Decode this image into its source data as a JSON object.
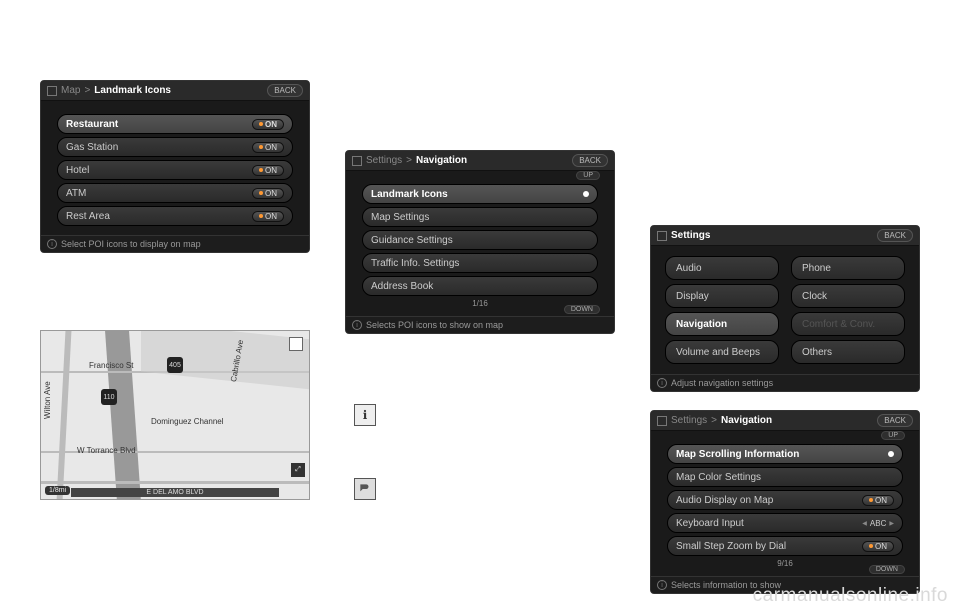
{
  "common": {
    "back_label": "BACK",
    "up_label": "UP",
    "down_label": "DOWN",
    "on_label": "ON"
  },
  "landmark_panel": {
    "breadcrumb_root": "Map",
    "breadcrumb_sep": ">",
    "breadcrumb_leaf": "Landmark Icons",
    "items": [
      {
        "label": "Restaurant",
        "on": true,
        "selected": true
      },
      {
        "label": "Gas Station",
        "on": true
      },
      {
        "label": "Hotel",
        "on": true
      },
      {
        "label": "ATM",
        "on": true
      },
      {
        "label": "Rest Area",
        "on": true
      }
    ],
    "hint": "Select POI icons to display on map"
  },
  "nav_panel": {
    "breadcrumb_root": "Settings",
    "breadcrumb_sep": ">",
    "breadcrumb_leaf": "Navigation",
    "items": [
      {
        "label": "Landmark Icons",
        "selected": true
      },
      {
        "label": "Map Settings"
      },
      {
        "label": "Guidance Settings"
      },
      {
        "label": "Traffic Info. Settings"
      },
      {
        "label": "Address Book"
      }
    ],
    "page": "1/16",
    "hint": "Selects POI icons to show on map"
  },
  "settings_panel": {
    "title": "Settings",
    "left": [
      {
        "label": "Audio"
      },
      {
        "label": "Display"
      },
      {
        "label": "Navigation",
        "selected": true
      },
      {
        "label": "Volume and Beeps"
      }
    ],
    "right": [
      {
        "label": "Phone"
      },
      {
        "label": "Clock"
      },
      {
        "label": "Comfort & Conv.",
        "disabled": true
      },
      {
        "label": "Others"
      }
    ],
    "hint": "Adjust navigation settings"
  },
  "nav2_panel": {
    "breadcrumb_root": "Settings",
    "breadcrumb_sep": ">",
    "breadcrumb_leaf": "Navigation",
    "items": [
      {
        "label": "Map Scrolling Information",
        "selected": true
      },
      {
        "label": "Map Color Settings"
      },
      {
        "label": "Audio Display on Map",
        "on": true
      },
      {
        "label": "Keyboard Input",
        "value": "ABC"
      },
      {
        "label": "Small Step Zoom by Dial",
        "on": true
      }
    ],
    "page": "9/16",
    "hint": "Selects information to show"
  },
  "map": {
    "scale": "1/8mi",
    "road_bottom": "E DEL AMO BLVD",
    "labels": {
      "francisco": "Francisco St",
      "torrance": "W Torrance Blvd",
      "dominguez": "Dominguez Channel",
      "wilton": "Wilton Ave",
      "cabrillo": "Cabrillo Ave",
      "hwy110": "110",
      "hwy405": "405"
    }
  },
  "watermark": "carmanualsonline.info"
}
